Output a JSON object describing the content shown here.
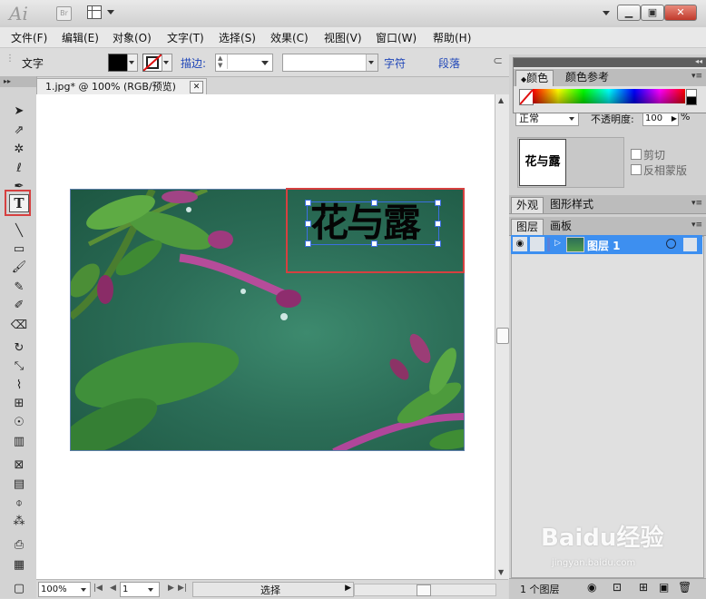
{
  "titlebar": {
    "app_logo": "Ai",
    "bridge_logo": "Br"
  },
  "menu": [
    "文件(F)",
    "编辑(E)",
    "对象(O)",
    "文字(T)",
    "选择(S)",
    "效果(C)",
    "视图(V)",
    "窗口(W)",
    "帮助(H)"
  ],
  "controlbar": {
    "tool_name": "文字",
    "stroke_label": "描边:",
    "char_link": "字符",
    "para_link": "段落"
  },
  "document": {
    "tab_title": "1.jpg* @ 100% (RGB/预览)",
    "photo_text": "花与露"
  },
  "statusbar": {
    "zoom": "100%",
    "page": "1",
    "status": "选择"
  },
  "panels": {
    "color_tabs": [
      "颜色",
      "颜色参考"
    ],
    "transparency": {
      "mode": "正常",
      "opacity_label": "不透明度:",
      "opacity_value": "100",
      "unit": "%"
    },
    "thumbnail_text": "花与露",
    "clip_label": "剪切",
    "invert_mask_label": "反相蒙版",
    "appearance_tabs": [
      "外观",
      "图形样式"
    ],
    "layers_tabs": [
      "图层",
      "画板"
    ],
    "layer_name": "图层 1",
    "layer_count": "1 个图层"
  },
  "watermark": {
    "brand": "Baidu经验",
    "url": "jingyan.baidu.com"
  },
  "colors": {
    "accent_blue": "#3d8ff0",
    "highlight_red": "#d64040",
    "link_blue": "#1f46b8"
  },
  "icons": [
    "arrange-icon",
    "minimize-icon",
    "restore-icon",
    "close-icon",
    "selection-icon",
    "direct-selection-icon",
    "magic-wand-icon",
    "lasso-icon",
    "pen-icon",
    "type-icon",
    "line-icon",
    "rectangle-icon",
    "paintbrush-icon",
    "pencil-icon",
    "eraser-icon",
    "rotate-icon",
    "scale-icon",
    "warp-icon",
    "free-transform-icon",
    "symbol-sprayer-icon",
    "column-graph-icon",
    "mesh-icon",
    "gradient-icon",
    "eyedropper-icon",
    "blend-icon",
    "slice-icon",
    "hand-icon",
    "zoom-icon",
    "eye-icon",
    "target-icon",
    "new-layer-icon",
    "trash-icon"
  ]
}
